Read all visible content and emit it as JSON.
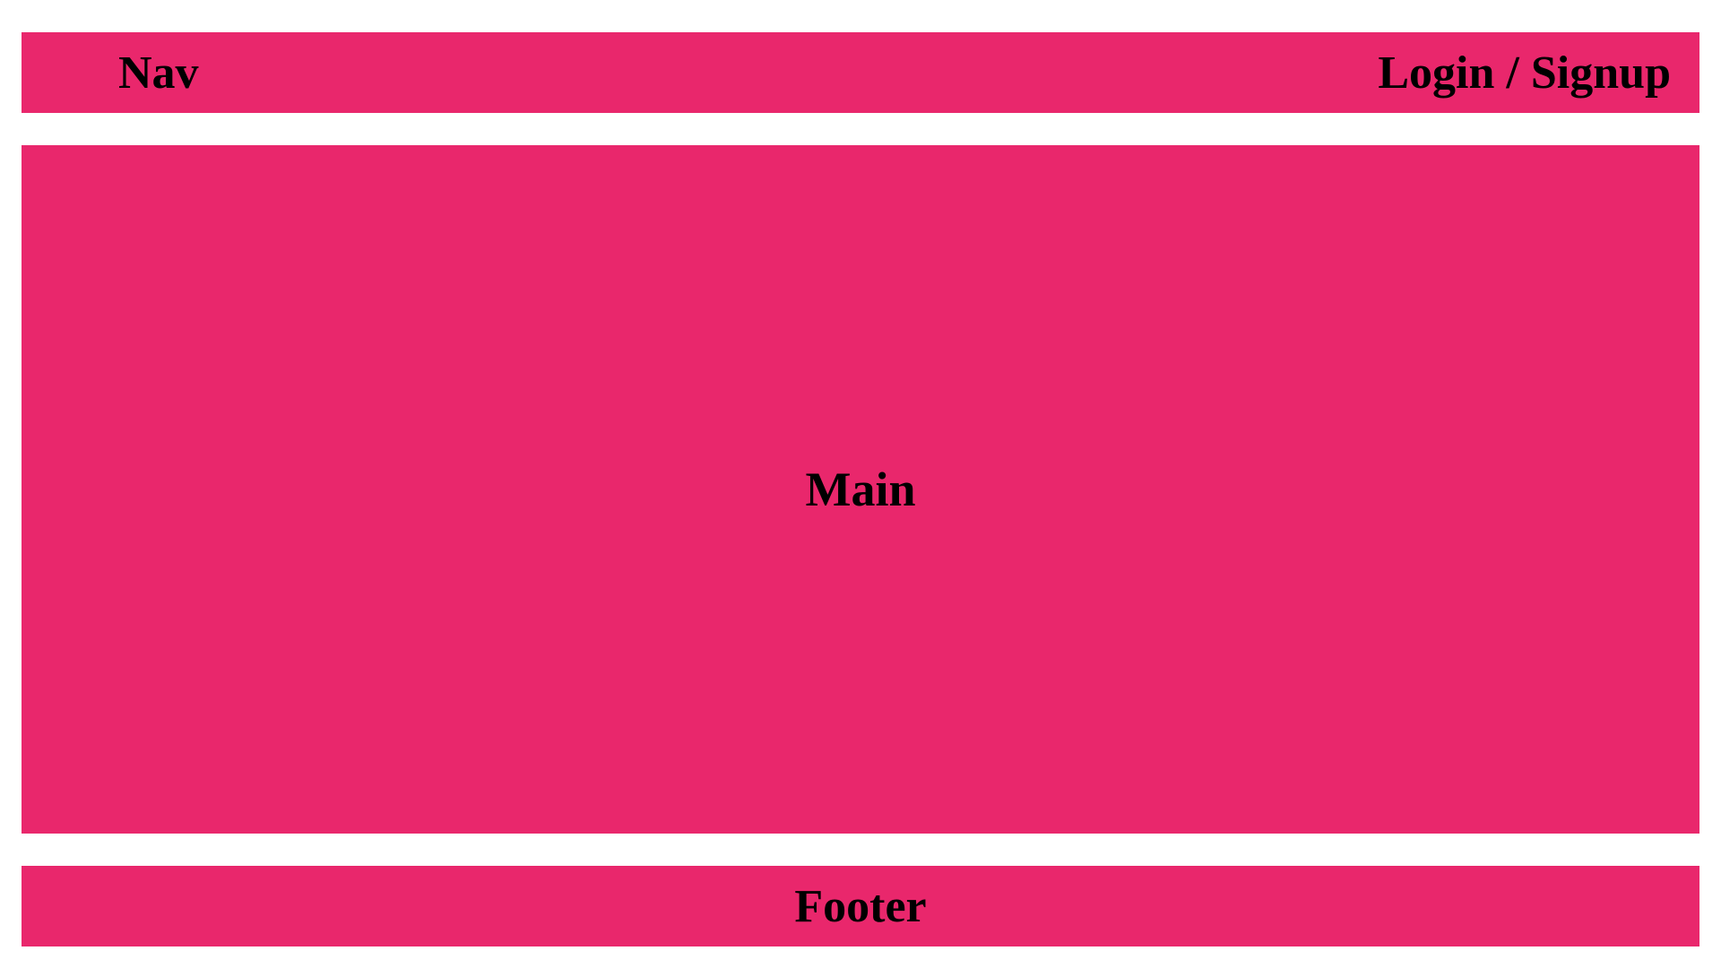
{
  "colors": {
    "block_bg": "#e9276c",
    "text": "#000000",
    "page_bg": "#ffffff"
  },
  "header": {
    "nav_label": "Nav",
    "auth_label": "Login / Signup"
  },
  "main": {
    "label": "Main"
  },
  "footer": {
    "label": "Footer"
  }
}
